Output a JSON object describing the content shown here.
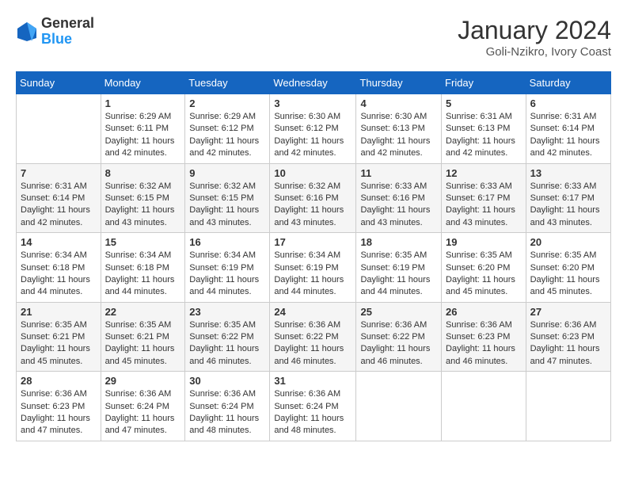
{
  "header": {
    "logo": {
      "general": "General",
      "blue": "Blue"
    },
    "title": "January 2024",
    "location": "Goli-Nzikro, Ivory Coast"
  },
  "calendar": {
    "days_of_week": [
      "Sunday",
      "Monday",
      "Tuesday",
      "Wednesday",
      "Thursday",
      "Friday",
      "Saturday"
    ],
    "weeks": [
      [
        {
          "day": "",
          "info": ""
        },
        {
          "day": "1",
          "info": "Sunrise: 6:29 AM\nSunset: 6:11 PM\nDaylight: 11 hours\nand 42 minutes."
        },
        {
          "day": "2",
          "info": "Sunrise: 6:29 AM\nSunset: 6:12 PM\nDaylight: 11 hours\nand 42 minutes."
        },
        {
          "day": "3",
          "info": "Sunrise: 6:30 AM\nSunset: 6:12 PM\nDaylight: 11 hours\nand 42 minutes."
        },
        {
          "day": "4",
          "info": "Sunrise: 6:30 AM\nSunset: 6:13 PM\nDaylight: 11 hours\nand 42 minutes."
        },
        {
          "day": "5",
          "info": "Sunrise: 6:31 AM\nSunset: 6:13 PM\nDaylight: 11 hours\nand 42 minutes."
        },
        {
          "day": "6",
          "info": "Sunrise: 6:31 AM\nSunset: 6:14 PM\nDaylight: 11 hours\nand 42 minutes."
        }
      ],
      [
        {
          "day": "7",
          "info": "Sunrise: 6:31 AM\nSunset: 6:14 PM\nDaylight: 11 hours\nand 42 minutes."
        },
        {
          "day": "8",
          "info": "Sunrise: 6:32 AM\nSunset: 6:15 PM\nDaylight: 11 hours\nand 43 minutes."
        },
        {
          "day": "9",
          "info": "Sunrise: 6:32 AM\nSunset: 6:15 PM\nDaylight: 11 hours\nand 43 minutes."
        },
        {
          "day": "10",
          "info": "Sunrise: 6:32 AM\nSunset: 6:16 PM\nDaylight: 11 hours\nand 43 minutes."
        },
        {
          "day": "11",
          "info": "Sunrise: 6:33 AM\nSunset: 6:16 PM\nDaylight: 11 hours\nand 43 minutes."
        },
        {
          "day": "12",
          "info": "Sunrise: 6:33 AM\nSunset: 6:17 PM\nDaylight: 11 hours\nand 43 minutes."
        },
        {
          "day": "13",
          "info": "Sunrise: 6:33 AM\nSunset: 6:17 PM\nDaylight: 11 hours\nand 43 minutes."
        }
      ],
      [
        {
          "day": "14",
          "info": "Sunrise: 6:34 AM\nSunset: 6:18 PM\nDaylight: 11 hours\nand 44 minutes."
        },
        {
          "day": "15",
          "info": "Sunrise: 6:34 AM\nSunset: 6:18 PM\nDaylight: 11 hours\nand 44 minutes."
        },
        {
          "day": "16",
          "info": "Sunrise: 6:34 AM\nSunset: 6:19 PM\nDaylight: 11 hours\nand 44 minutes."
        },
        {
          "day": "17",
          "info": "Sunrise: 6:34 AM\nSunset: 6:19 PM\nDaylight: 11 hours\nand 44 minutes."
        },
        {
          "day": "18",
          "info": "Sunrise: 6:35 AM\nSunset: 6:19 PM\nDaylight: 11 hours\nand 44 minutes."
        },
        {
          "day": "19",
          "info": "Sunrise: 6:35 AM\nSunset: 6:20 PM\nDaylight: 11 hours\nand 45 minutes."
        },
        {
          "day": "20",
          "info": "Sunrise: 6:35 AM\nSunset: 6:20 PM\nDaylight: 11 hours\nand 45 minutes."
        }
      ],
      [
        {
          "day": "21",
          "info": "Sunrise: 6:35 AM\nSunset: 6:21 PM\nDaylight: 11 hours\nand 45 minutes."
        },
        {
          "day": "22",
          "info": "Sunrise: 6:35 AM\nSunset: 6:21 PM\nDaylight: 11 hours\nand 45 minutes."
        },
        {
          "day": "23",
          "info": "Sunrise: 6:35 AM\nSunset: 6:22 PM\nDaylight: 11 hours\nand 46 minutes."
        },
        {
          "day": "24",
          "info": "Sunrise: 6:36 AM\nSunset: 6:22 PM\nDaylight: 11 hours\nand 46 minutes."
        },
        {
          "day": "25",
          "info": "Sunrise: 6:36 AM\nSunset: 6:22 PM\nDaylight: 11 hours\nand 46 minutes."
        },
        {
          "day": "26",
          "info": "Sunrise: 6:36 AM\nSunset: 6:23 PM\nDaylight: 11 hours\nand 46 minutes."
        },
        {
          "day": "27",
          "info": "Sunrise: 6:36 AM\nSunset: 6:23 PM\nDaylight: 11 hours\nand 47 minutes."
        }
      ],
      [
        {
          "day": "28",
          "info": "Sunrise: 6:36 AM\nSunset: 6:23 PM\nDaylight: 11 hours\nand 47 minutes."
        },
        {
          "day": "29",
          "info": "Sunrise: 6:36 AM\nSunset: 6:24 PM\nDaylight: 11 hours\nand 47 minutes."
        },
        {
          "day": "30",
          "info": "Sunrise: 6:36 AM\nSunset: 6:24 PM\nDaylight: 11 hours\nand 48 minutes."
        },
        {
          "day": "31",
          "info": "Sunrise: 6:36 AM\nSunset: 6:24 PM\nDaylight: 11 hours\nand 48 minutes."
        },
        {
          "day": "",
          "info": ""
        },
        {
          "day": "",
          "info": ""
        },
        {
          "day": "",
          "info": ""
        }
      ]
    ]
  }
}
